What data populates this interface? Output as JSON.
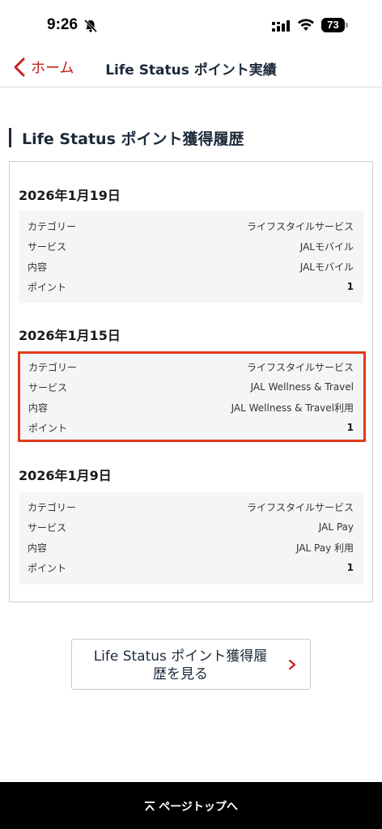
{
  "status_bar": {
    "time": "9:26",
    "battery": "73"
  },
  "nav": {
    "back_label": "ホーム",
    "title": "Life Status ポイント実績"
  },
  "section": {
    "heading": "Life Status ポイント獲得履歴"
  },
  "labels": {
    "category": "カテゴリー",
    "service": "サービス",
    "content": "内容",
    "points": "ポイント"
  },
  "entries": [
    {
      "date": "2026年1月19日",
      "category": "ライフスタイルサービス",
      "service": "JALモバイル",
      "content": "JALモバイル",
      "points": "1"
    },
    {
      "date": "2026年1月15日",
      "category": "ライフスタイルサービス",
      "service": "JAL Wellness & Travel",
      "content": "JAL Wellness & Travel利用",
      "points": "1"
    },
    {
      "date": "2026年1月9日",
      "category": "ライフスタイルサービス",
      "service": "JAL Pay",
      "content": "JAL Pay 利用",
      "points": "1"
    }
  ],
  "cta": {
    "line1": "Life Status ポイント獲得履",
    "line2": "歴を見る"
  },
  "footer": {
    "page_top_label": "ページトップへ"
  },
  "colors": {
    "accent_red": "#c8201e",
    "highlight": "#e23a1c",
    "navy": "#1c2a3a"
  }
}
